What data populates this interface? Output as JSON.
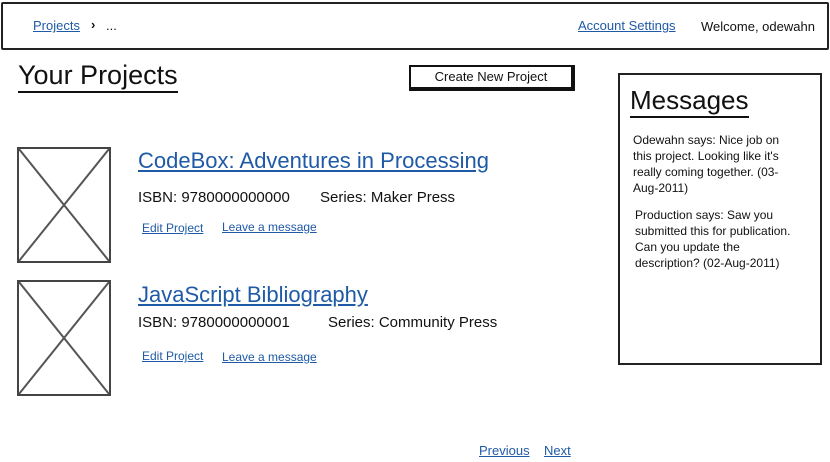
{
  "header": {
    "breadcrumb": {
      "projects": "Projects",
      "separator": "›",
      "ellipsis": "..."
    },
    "account_settings": "Account Settings",
    "welcome": "Welcome, odewahn"
  },
  "main": {
    "title": "Your Projects",
    "create_button": "Create New Project",
    "projects": [
      {
        "title": "CodeBox: Adventures in Processing",
        "isbn": "ISBN: 9780000000000",
        "series": "Series: Maker Press",
        "edit": "Edit Project",
        "leave_message": "Leave a message"
      },
      {
        "title": "JavaScript Bibliography",
        "isbn": "ISBN: 9780000000001",
        "series": "Series: Community Press",
        "edit": "Edit Project",
        "leave_message": "Leave a message"
      }
    ]
  },
  "messages": {
    "title": "Messages",
    "items": [
      {
        "text": "Odewahn says: Nice job on this project.  Looking like it's really coming together. (03-Aug-2011)"
      },
      {
        "text": "Production says: Saw you submitted this for publication. Can you update the description? (02-Aug-2011)"
      }
    ]
  },
  "pagination": {
    "previous": "Previous",
    "next": "Next"
  },
  "colors": {
    "link": "#1f5aa6",
    "border": "#222222"
  }
}
